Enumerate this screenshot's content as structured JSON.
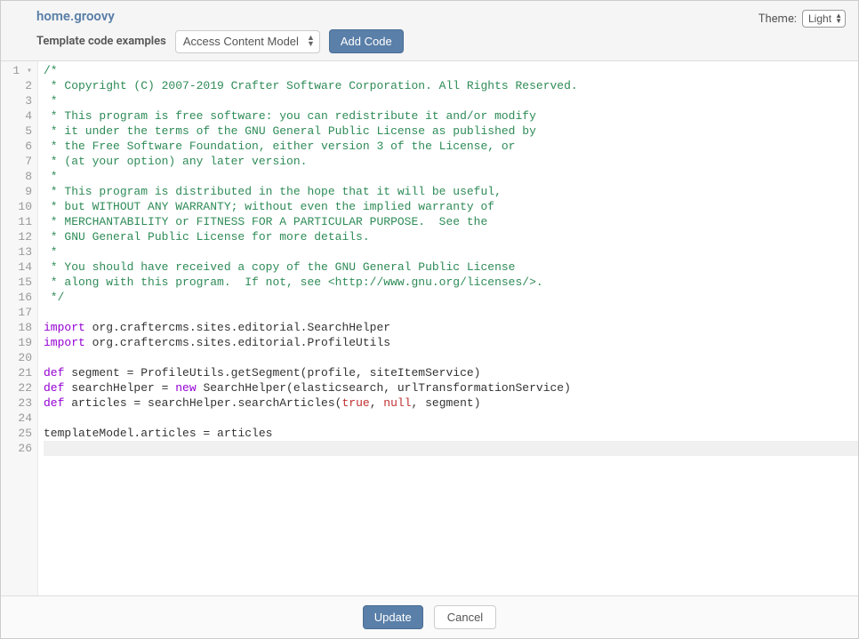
{
  "header": {
    "filename": "home.groovy",
    "toolbar_label": "Template code examples",
    "dropdown_selected": "Access Content Model",
    "add_code_label": "Add Code",
    "theme_label": "Theme:",
    "theme_selected": "Light"
  },
  "footer": {
    "update_label": "Update",
    "cancel_label": "Cancel"
  },
  "editor": {
    "lines": [
      {
        "n": 1,
        "fold": true,
        "tokens": [
          {
            "t": "/*",
            "c": "comment"
          }
        ]
      },
      {
        "n": 2,
        "tokens": [
          {
            "t": " * Copyright (C) 2007-2019 Crafter Software Corporation. All Rights Reserved.",
            "c": "comment"
          }
        ]
      },
      {
        "n": 3,
        "tokens": [
          {
            "t": " *",
            "c": "comment"
          }
        ]
      },
      {
        "n": 4,
        "tokens": [
          {
            "t": " * This program is free software: you can redistribute it and/or modify",
            "c": "comment"
          }
        ]
      },
      {
        "n": 5,
        "tokens": [
          {
            "t": " * it under the terms of the GNU General Public License as published by",
            "c": "comment"
          }
        ]
      },
      {
        "n": 6,
        "tokens": [
          {
            "t": " * the Free Software Foundation, either version 3 of the License, or",
            "c": "comment"
          }
        ]
      },
      {
        "n": 7,
        "tokens": [
          {
            "t": " * (at your option) any later version.",
            "c": "comment"
          }
        ]
      },
      {
        "n": 8,
        "tokens": [
          {
            "t": " *",
            "c": "comment"
          }
        ]
      },
      {
        "n": 9,
        "tokens": [
          {
            "t": " * This program is distributed in the hope that it will be useful,",
            "c": "comment"
          }
        ]
      },
      {
        "n": 10,
        "tokens": [
          {
            "t": " * but WITHOUT ANY WARRANTY; without even the implied warranty of",
            "c": "comment"
          }
        ]
      },
      {
        "n": 11,
        "tokens": [
          {
            "t": " * MERCHANTABILITY or FITNESS FOR A PARTICULAR PURPOSE.  See the",
            "c": "comment"
          }
        ]
      },
      {
        "n": 12,
        "tokens": [
          {
            "t": " * GNU General Public License for more details.",
            "c": "comment"
          }
        ]
      },
      {
        "n": 13,
        "tokens": [
          {
            "t": " *",
            "c": "comment"
          }
        ]
      },
      {
        "n": 14,
        "tokens": [
          {
            "t": " * You should have received a copy of the GNU General Public License",
            "c": "comment"
          }
        ]
      },
      {
        "n": 15,
        "tokens": [
          {
            "t": " * along with this program.  If not, see <http://www.gnu.org/licenses/>.",
            "c": "comment"
          }
        ]
      },
      {
        "n": 16,
        "tokens": [
          {
            "t": " */",
            "c": "comment"
          }
        ]
      },
      {
        "n": 17,
        "tokens": []
      },
      {
        "n": 18,
        "tokens": [
          {
            "t": "import",
            "c": "keyword"
          },
          {
            "t": " org.craftercms.sites.editorial.SearchHelper",
            "c": "text"
          }
        ]
      },
      {
        "n": 19,
        "tokens": [
          {
            "t": "import",
            "c": "keyword"
          },
          {
            "t": " org.craftercms.sites.editorial.ProfileUtils",
            "c": "text"
          }
        ]
      },
      {
        "n": 20,
        "tokens": []
      },
      {
        "n": 21,
        "tokens": [
          {
            "t": "def",
            "c": "keyword"
          },
          {
            "t": " segment = ProfileUtils.getSegment(profile, siteItemService)",
            "c": "text"
          }
        ]
      },
      {
        "n": 22,
        "tokens": [
          {
            "t": "def",
            "c": "keyword"
          },
          {
            "t": " searchHelper = ",
            "c": "text"
          },
          {
            "t": "new",
            "c": "keyword"
          },
          {
            "t": " SearchHelper(elasticsearch, urlTransformationService)",
            "c": "text"
          }
        ]
      },
      {
        "n": 23,
        "tokens": [
          {
            "t": "def",
            "c": "keyword"
          },
          {
            "t": " articles = searchHelper.searchArticles(",
            "c": "text"
          },
          {
            "t": "true",
            "c": "literal"
          },
          {
            "t": ", ",
            "c": "text"
          },
          {
            "t": "null",
            "c": "literal"
          },
          {
            "t": ", segment)",
            "c": "text"
          }
        ]
      },
      {
        "n": 24,
        "tokens": []
      },
      {
        "n": 25,
        "tokens": [
          {
            "t": "templateModel.articles = articles",
            "c": "text"
          }
        ]
      },
      {
        "n": 26,
        "highlight": true,
        "tokens": []
      }
    ]
  }
}
